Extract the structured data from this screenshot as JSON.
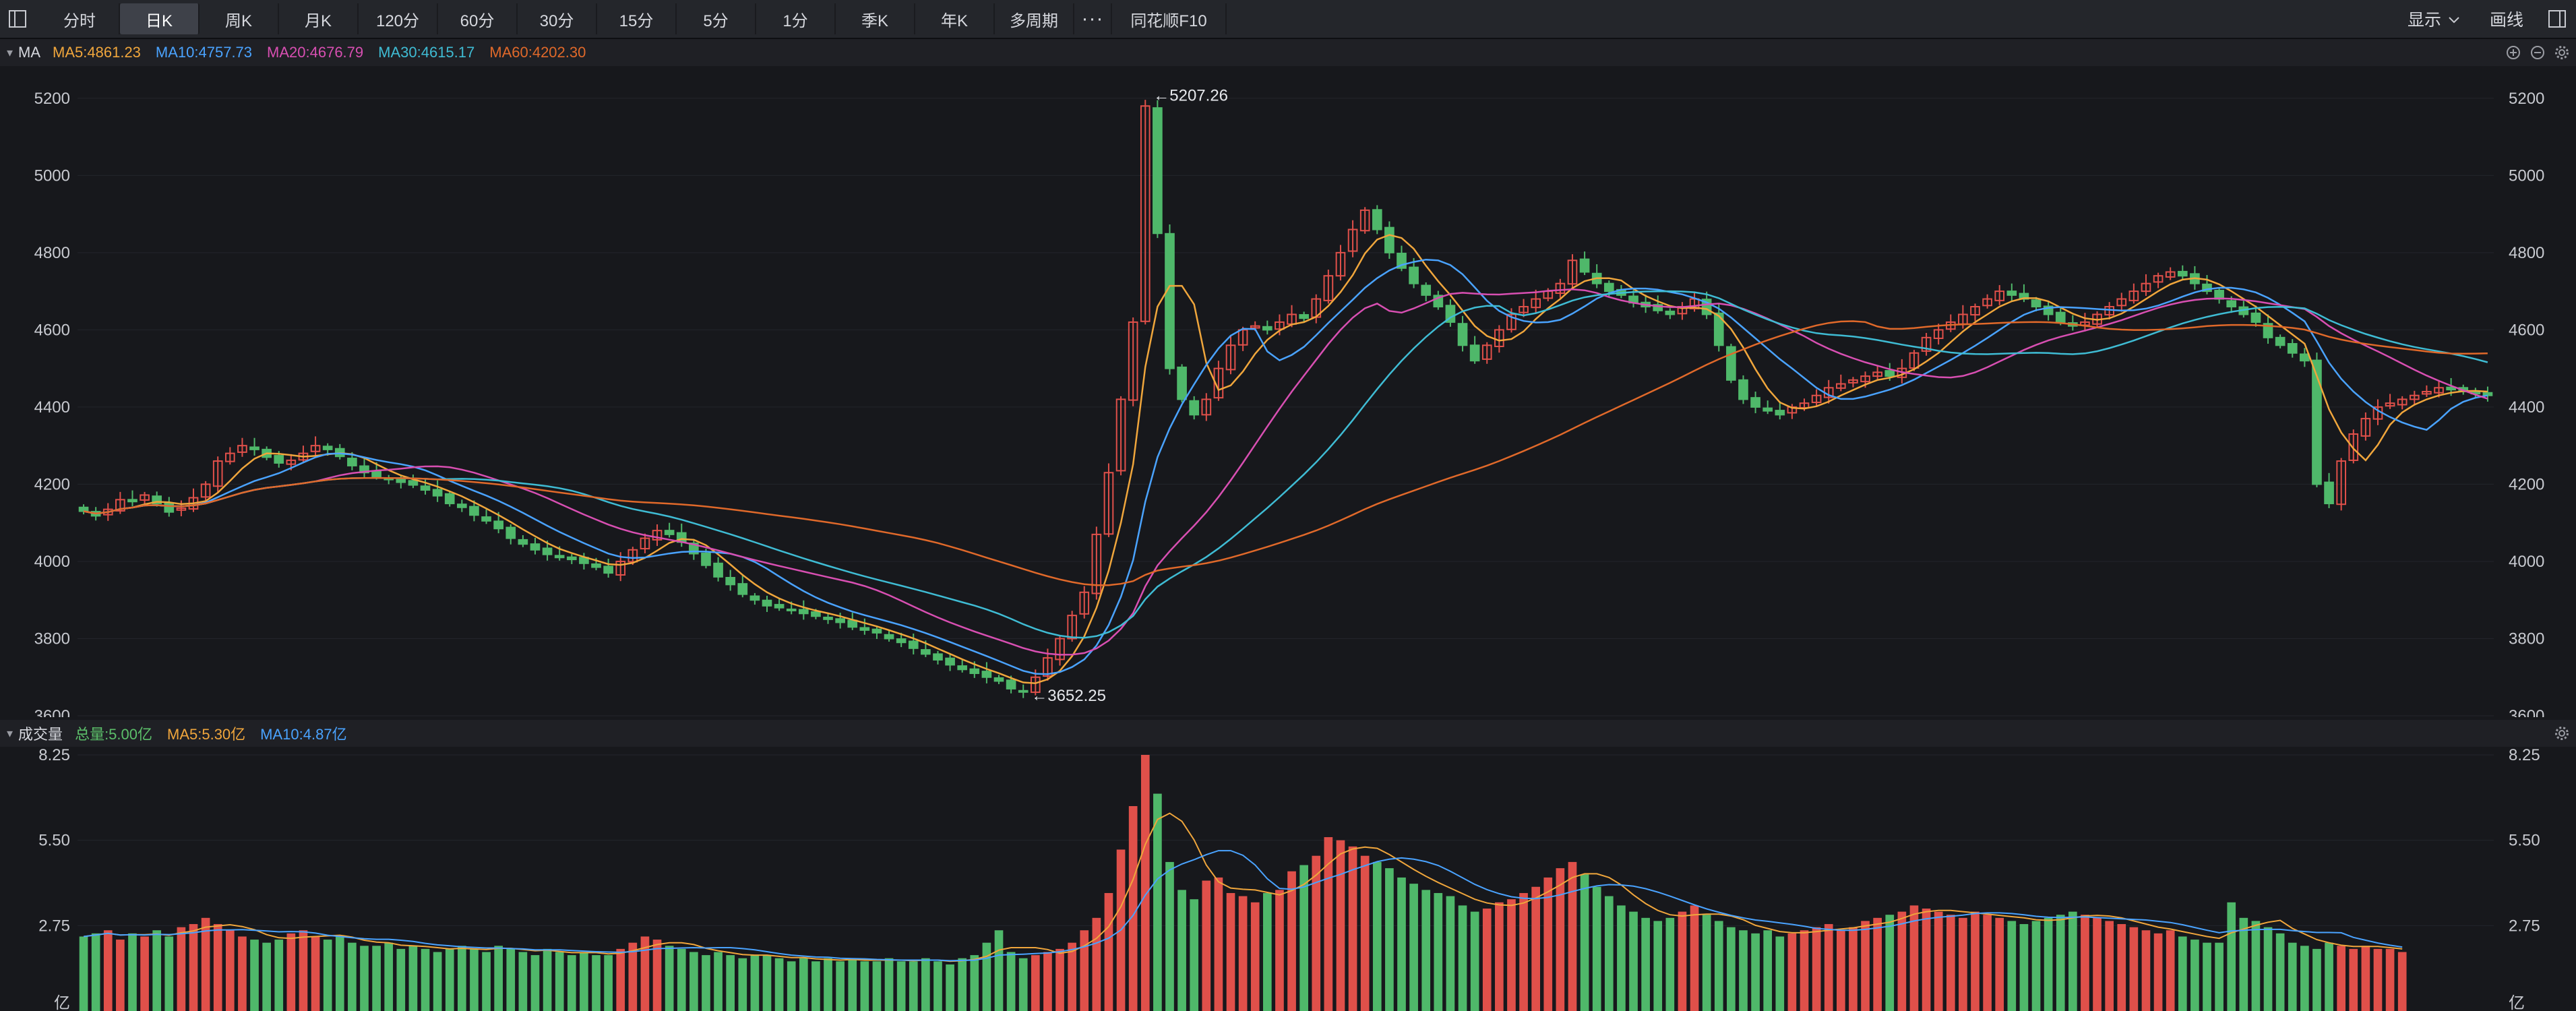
{
  "toolbar": {
    "tabs": [
      "分时",
      "日K",
      "周K",
      "月K",
      "120分",
      "60分",
      "30分",
      "15分",
      "5分",
      "1分",
      "季K",
      "年K",
      "多周期",
      "···",
      "同花顺F10"
    ],
    "active_tab": "日K",
    "display_label": "显示",
    "draw_label": "画线"
  },
  "price_panel": {
    "name": "MA",
    "indicators": [
      {
        "label": "MA5:4861.23",
        "color": "#f0a63c"
      },
      {
        "label": "MA10:4757.73",
        "color": "#4aa3ff"
      },
      {
        "label": "MA20:4676.79",
        "color": "#d84fb2"
      },
      {
        "label": "MA30:4615.17",
        "color": "#3fbcd4"
      },
      {
        "label": "MA60:4202.30",
        "color": "#e0692a"
      }
    ],
    "y_ticks": [
      5200,
      5000,
      4800,
      4600,
      4400,
      4200,
      4000,
      3800,
      3600
    ],
    "high_label": "←5207.26",
    "low_label": "←3652.25"
  },
  "volume_panel": {
    "name": "成交量",
    "indicators": [
      {
        "label": "总量:5.00亿",
        "color": "#5cbf6a"
      },
      {
        "label": "MA5:5.30亿",
        "color": "#f0a63c"
      },
      {
        "label": "MA10:4.87亿",
        "color": "#4aa3ff"
      }
    ],
    "y_ticks": [
      "8.25",
      "5.50",
      "2.75"
    ],
    "unit": "亿"
  },
  "colors": {
    "up": "#e0504a",
    "down": "#4fb86a",
    "bg": "#17181c",
    "grid": "#23252b"
  },
  "chart_data": {
    "type": "candlestick",
    "ylim": [
      3600,
      5280
    ],
    "volume_ylim": [
      0,
      8.25
    ],
    "high": 5207.26,
    "low": 3652.25,
    "closes": [
      4130,
      4118,
      4135,
      4160,
      4155,
      4172,
      4150,
      4128,
      4138,
      4165,
      4200,
      4260,
      4280,
      4300,
      4290,
      4270,
      4255,
      4262,
      4280,
      4300,
      4290,
      4272,
      4248,
      4230,
      4220,
      4212,
      4205,
      4198,
      4185,
      4170,
      4150,
      4140,
      4120,
      4105,
      4085,
      4060,
      4045,
      4030,
      4018,
      4010,
      4005,
      3995,
      3985,
      3970,
      4000,
      4030,
      4060,
      4080,
      4070,
      4050,
      4020,
      3990,
      3960,
      3940,
      3915,
      3900,
      3885,
      3880,
      3875,
      3865,
      3858,
      3850,
      3842,
      3830,
      3822,
      3815,
      3800,
      3790,
      3775,
      3760,
      3745,
      3732,
      3720,
      3710,
      3700,
      3690,
      3670,
      3662,
      3700,
      3750,
      3800,
      3860,
      3920,
      4070,
      4230,
      4420,
      4620,
      5180,
      4850,
      4500,
      4420,
      4380,
      4420,
      4500,
      4560,
      4600,
      4610,
      4600,
      4620,
      4640,
      4630,
      4680,
      4740,
      4800,
      4860,
      4910,
      4860,
      4800,
      4760,
      4720,
      4690,
      4660,
      4620,
      4560,
      4520,
      4560,
      4600,
      4640,
      4660,
      4680,
      4700,
      4720,
      4780,
      4750,
      4720,
      4700,
      4690,
      4670,
      4660,
      4650,
      4640,
      4660,
      4680,
      4640,
      4560,
      4470,
      4420,
      4400,
      4390,
      4380,
      4400,
      4410,
      4430,
      4450,
      4460,
      4470,
      4480,
      4490,
      4480,
      4500,
      4540,
      4580,
      4600,
      4620,
      4640,
      4660,
      4680,
      4700,
      4690,
      4680,
      4660,
      4640,
      4620,
      4610,
      4620,
      4640,
      4660,
      4680,
      4700,
      4720,
      4740,
      4750,
      4740,
      4720,
      4700,
      4680,
      4660,
      4640,
      4620,
      4580,
      4560,
      4540,
      4520,
      4200,
      4150,
      4260,
      4330,
      4370,
      4400,
      4410,
      4420,
      4430,
      4440,
      4450,
      4445,
      4440,
      4435,
      4430
    ],
    "volumes": [
      2.4,
      2.5,
      2.6,
      2.3,
      2.5,
      2.4,
      2.6,
      2.4,
      2.7,
      2.8,
      3.0,
      2.8,
      2.6,
      2.4,
      2.3,
      2.2,
      2.3,
      2.5,
      2.6,
      2.4,
      2.3,
      2.4,
      2.2,
      2.1,
      2.1,
      2.2,
      2.0,
      2.1,
      2.0,
      1.9,
      2.0,
      2.1,
      2.0,
      1.9,
      2.1,
      2.0,
      1.9,
      1.8,
      2.0,
      1.9,
      1.8,
      1.9,
      1.8,
      1.8,
      2.0,
      2.2,
      2.4,
      2.3,
      2.1,
      2.0,
      1.9,
      1.8,
      1.9,
      1.8,
      1.7,
      1.8,
      1.8,
      1.7,
      1.6,
      1.7,
      1.6,
      1.7,
      1.6,
      1.7,
      1.6,
      1.6,
      1.7,
      1.6,
      1.6,
      1.7,
      1.6,
      1.5,
      1.7,
      1.8,
      2.2,
      2.6,
      1.9,
      1.7,
      1.8,
      1.9,
      2.0,
      2.2,
      2.6,
      3.0,
      3.8,
      5.2,
      6.6,
      8.25,
      7.0,
      4.8,
      3.9,
      3.6,
      4.2,
      4.3,
      3.8,
      3.7,
      3.5,
      3.8,
      3.9,
      4.5,
      4.7,
      5.0,
      5.6,
      5.5,
      5.3,
      5.0,
      4.8,
      4.6,
      4.3,
      4.1,
      3.9,
      3.8,
      3.7,
      3.4,
      3.2,
      3.3,
      3.5,
      3.6,
      3.8,
      4.0,
      4.3,
      4.6,
      4.8,
      4.4,
      4.0,
      3.7,
      3.4,
      3.2,
      3.0,
      2.9,
      3.0,
      3.2,
      3.4,
      3.1,
      2.9,
      2.7,
      2.6,
      2.5,
      2.6,
      2.4,
      2.5,
      2.6,
      2.7,
      2.8,
      2.6,
      2.7,
      2.9,
      3.0,
      3.1,
      3.2,
      3.4,
      3.3,
      3.2,
      3.1,
      3.0,
      3.2,
      3.1,
      3.0,
      2.9,
      2.8,
      2.9,
      3.0,
      3.1,
      3.2,
      3.1,
      3.0,
      2.9,
      2.8,
      2.7,
      2.6,
      2.5,
      2.6,
      2.4,
      2.3,
      2.2,
      2.2,
      3.5,
      3.0,
      2.9,
      2.7,
      2.5,
      2.2,
      2.1,
      2.0,
      2.2,
      2.1,
      2.0,
      2.1,
      2.0,
      2.0,
      1.9
    ]
  }
}
